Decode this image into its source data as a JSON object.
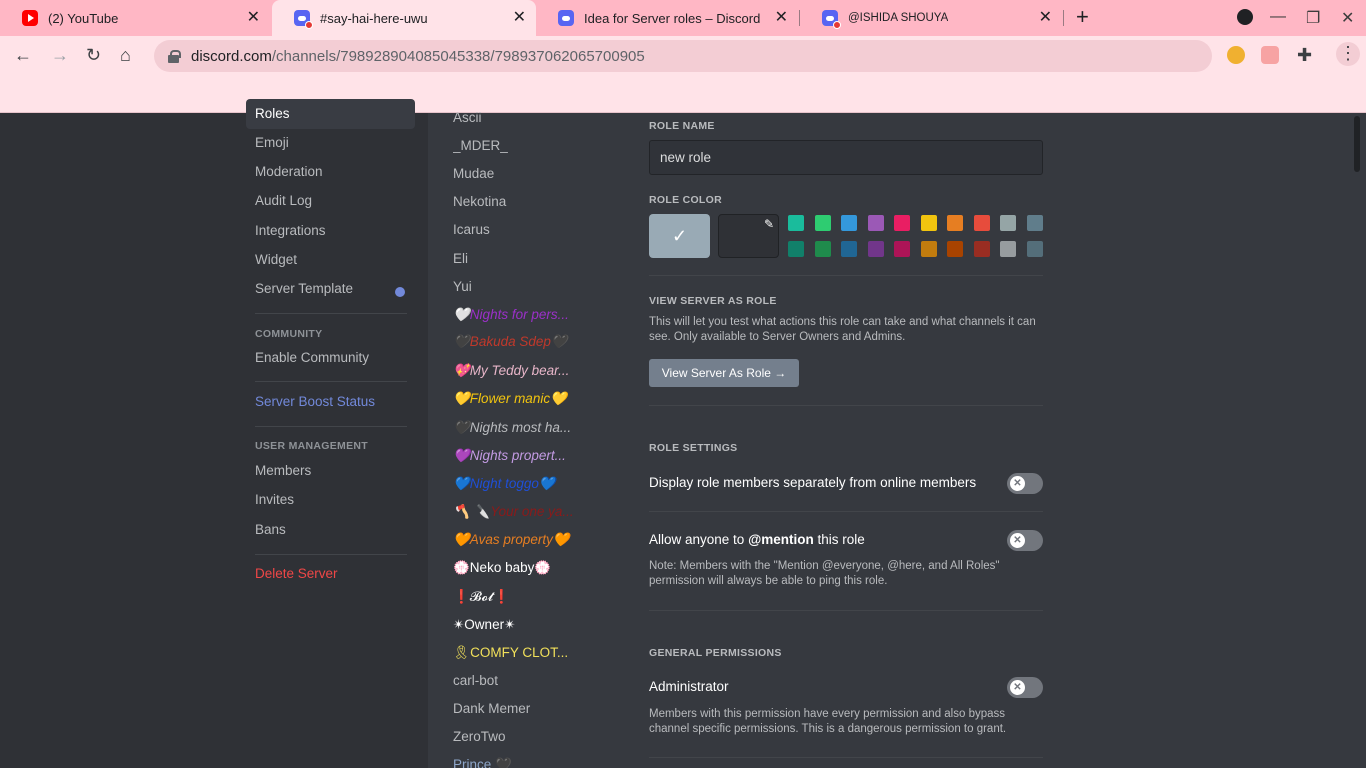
{
  "browser": {
    "tabs": [
      {
        "title": "(2) YouTube",
        "icon": "youtube-icon"
      },
      {
        "title": "#say-hai-here-uwu",
        "icon": "discord-icon"
      },
      {
        "title": "Idea for Server roles – Discord",
        "icon": "discord-icon"
      },
      {
        "title": "@ISHIDA SHOUYA",
        "icon": "discord-icon"
      }
    ],
    "url_domain": "discord.com",
    "url_path": "/channels/798928904085045338/798937062065700905"
  },
  "sidebar": {
    "items": [
      {
        "label": "Roles"
      },
      {
        "label": "Emoji"
      },
      {
        "label": "Moderation"
      },
      {
        "label": "Audit Log"
      },
      {
        "label": "Integrations"
      },
      {
        "label": "Widget"
      },
      {
        "label": "Server Template"
      }
    ],
    "community_header": "COMMUNITY",
    "enable_community": "Enable Community",
    "boost_status": "Server Boost Status",
    "user_mgmt_header": "USER MANAGEMENT",
    "members": "Members",
    "invites": "Invites",
    "bans": "Bans",
    "delete_server": "Delete Server"
  },
  "roles": [
    {
      "name": "Ascii",
      "color": "#b9bbbe"
    },
    {
      "name": "_MDER_",
      "color": "#b9bbbe"
    },
    {
      "name": "Mudae",
      "color": "#b9bbbe"
    },
    {
      "name": "Nekotina",
      "color": "#b9bbbe"
    },
    {
      "name": "Icarus",
      "color": "#b9bbbe"
    },
    {
      "name": "Eli",
      "color": "#b9bbbe"
    },
    {
      "name": "Yui",
      "color": "#b9bbbe"
    },
    {
      "name": "🤍Nights for pers...",
      "color": "#9b30c9"
    },
    {
      "name": "🖤Bakuda Sdep🖤",
      "color": "#c0392b"
    },
    {
      "name": "💖My Teddy bear...",
      "color": "#e8b6c9"
    },
    {
      "name": "💛Flower manic💛",
      "color": "#f1c40f"
    },
    {
      "name": "🖤Nights most ha...",
      "color": "#b9bbbe"
    },
    {
      "name": "💜Nights propert...",
      "color": "#c39be3"
    },
    {
      "name": "💙Night toggo💙",
      "color": "#1f4fd6"
    },
    {
      "name": "🪓 🔪Your one ya...",
      "color": "#8b1a1a"
    },
    {
      "name": "🧡Avas property🧡",
      "color": "#e67e22"
    },
    {
      "name": "💮Neko baby💮",
      "color": "#ffffff"
    },
    {
      "name": "❗𝓑𝓸𝓽❗",
      "color": "#ffffff"
    },
    {
      "name": "✴Owner✴",
      "color": "#ffffff"
    },
    {
      "name": "🎗COMFY CLOT...",
      "color": "#f1e05a"
    },
    {
      "name": "carl-bot",
      "color": "#b9bbbe"
    },
    {
      "name": "Dank Memer",
      "color": "#b9bbbe"
    },
    {
      "name": "ZeroTwo",
      "color": "#b9bbbe"
    },
    {
      "name": "Prince 🖤",
      "color": "#8ea6c9"
    }
  ],
  "main": {
    "role_name_label": "ROLE NAME",
    "role_name_value": "new role",
    "role_color_label": "ROLE COLOR",
    "selected_color": "#99aab5",
    "check_glyph": "✓",
    "swatches_row1": [
      "#1abc9c",
      "#2ecc71",
      "#3498db",
      "#9b59b6",
      "#e91e63",
      "#f1c40f",
      "#e67e22",
      "#e74c3c",
      "#95a5a6",
      "#607d8b"
    ],
    "swatches_row2": [
      "#11806a",
      "#1f8b4c",
      "#206694",
      "#71368a",
      "#ad1457",
      "#c27c0e",
      "#a84300",
      "#992d22",
      "#979c9f",
      "#546e7a"
    ],
    "view_as_role_label": "VIEW SERVER AS ROLE",
    "view_as_role_desc": "This will let you test what actions this role can take and what channels it can see. Only available to Server Owners and Admins.",
    "view_as_role_button": "View Server As Role →",
    "role_settings_label": "ROLE SETTINGS",
    "display_separately": "Display role members separately from online members",
    "mention_prefix": "Allow anyone to ",
    "mention_bold": "@mention",
    "mention_suffix": " this role",
    "mention_note": "Note: Members with the \"Mention @everyone, @here, and All Roles\" permission will always be able to ping this role.",
    "general_perms_label": "GENERAL PERMISSIONS",
    "administrator": "Administrator",
    "administrator_desc": "Members with this permission have every permission and also bypass channel specific permissions. This is a dangerous permission to grant."
  }
}
